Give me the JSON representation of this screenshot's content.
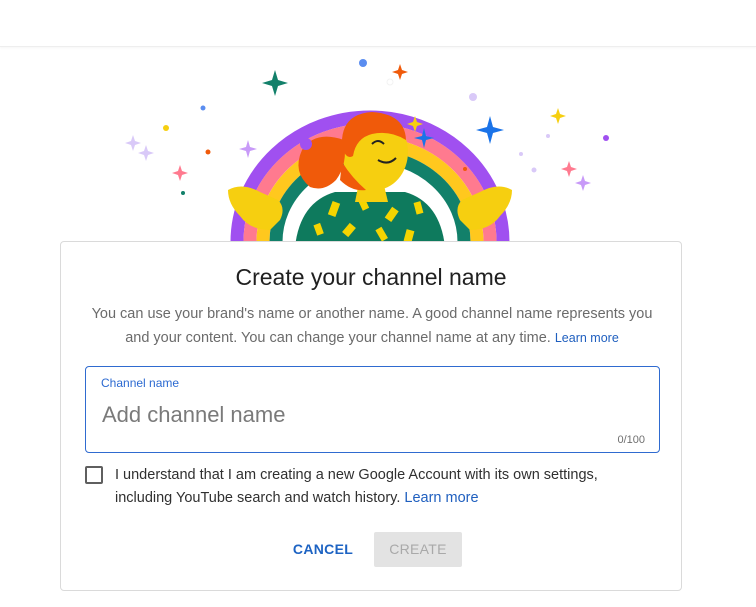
{
  "dialog": {
    "title": "Create your channel name",
    "description": "You can use your brand's name or another name. A good channel name represents you and your content. You can change your channel name at any time.",
    "description_link": "Learn more",
    "field": {
      "label": "Channel name",
      "placeholder": "Add channel name",
      "value": "",
      "counter": "0/100"
    },
    "consent": {
      "checked": false,
      "text": "I understand that I am creating a new Google Account with its own settings, including YouTube search and watch history.",
      "link": "Learn more"
    },
    "buttons": {
      "cancel": "CANCEL",
      "create": "CREATE"
    }
  },
  "colors": {
    "accent": "#1f5fbf",
    "focus_border": "#2f6bd0",
    "disabled_bg": "#e3e3e3",
    "disabled_text": "#a9a9a9"
  }
}
